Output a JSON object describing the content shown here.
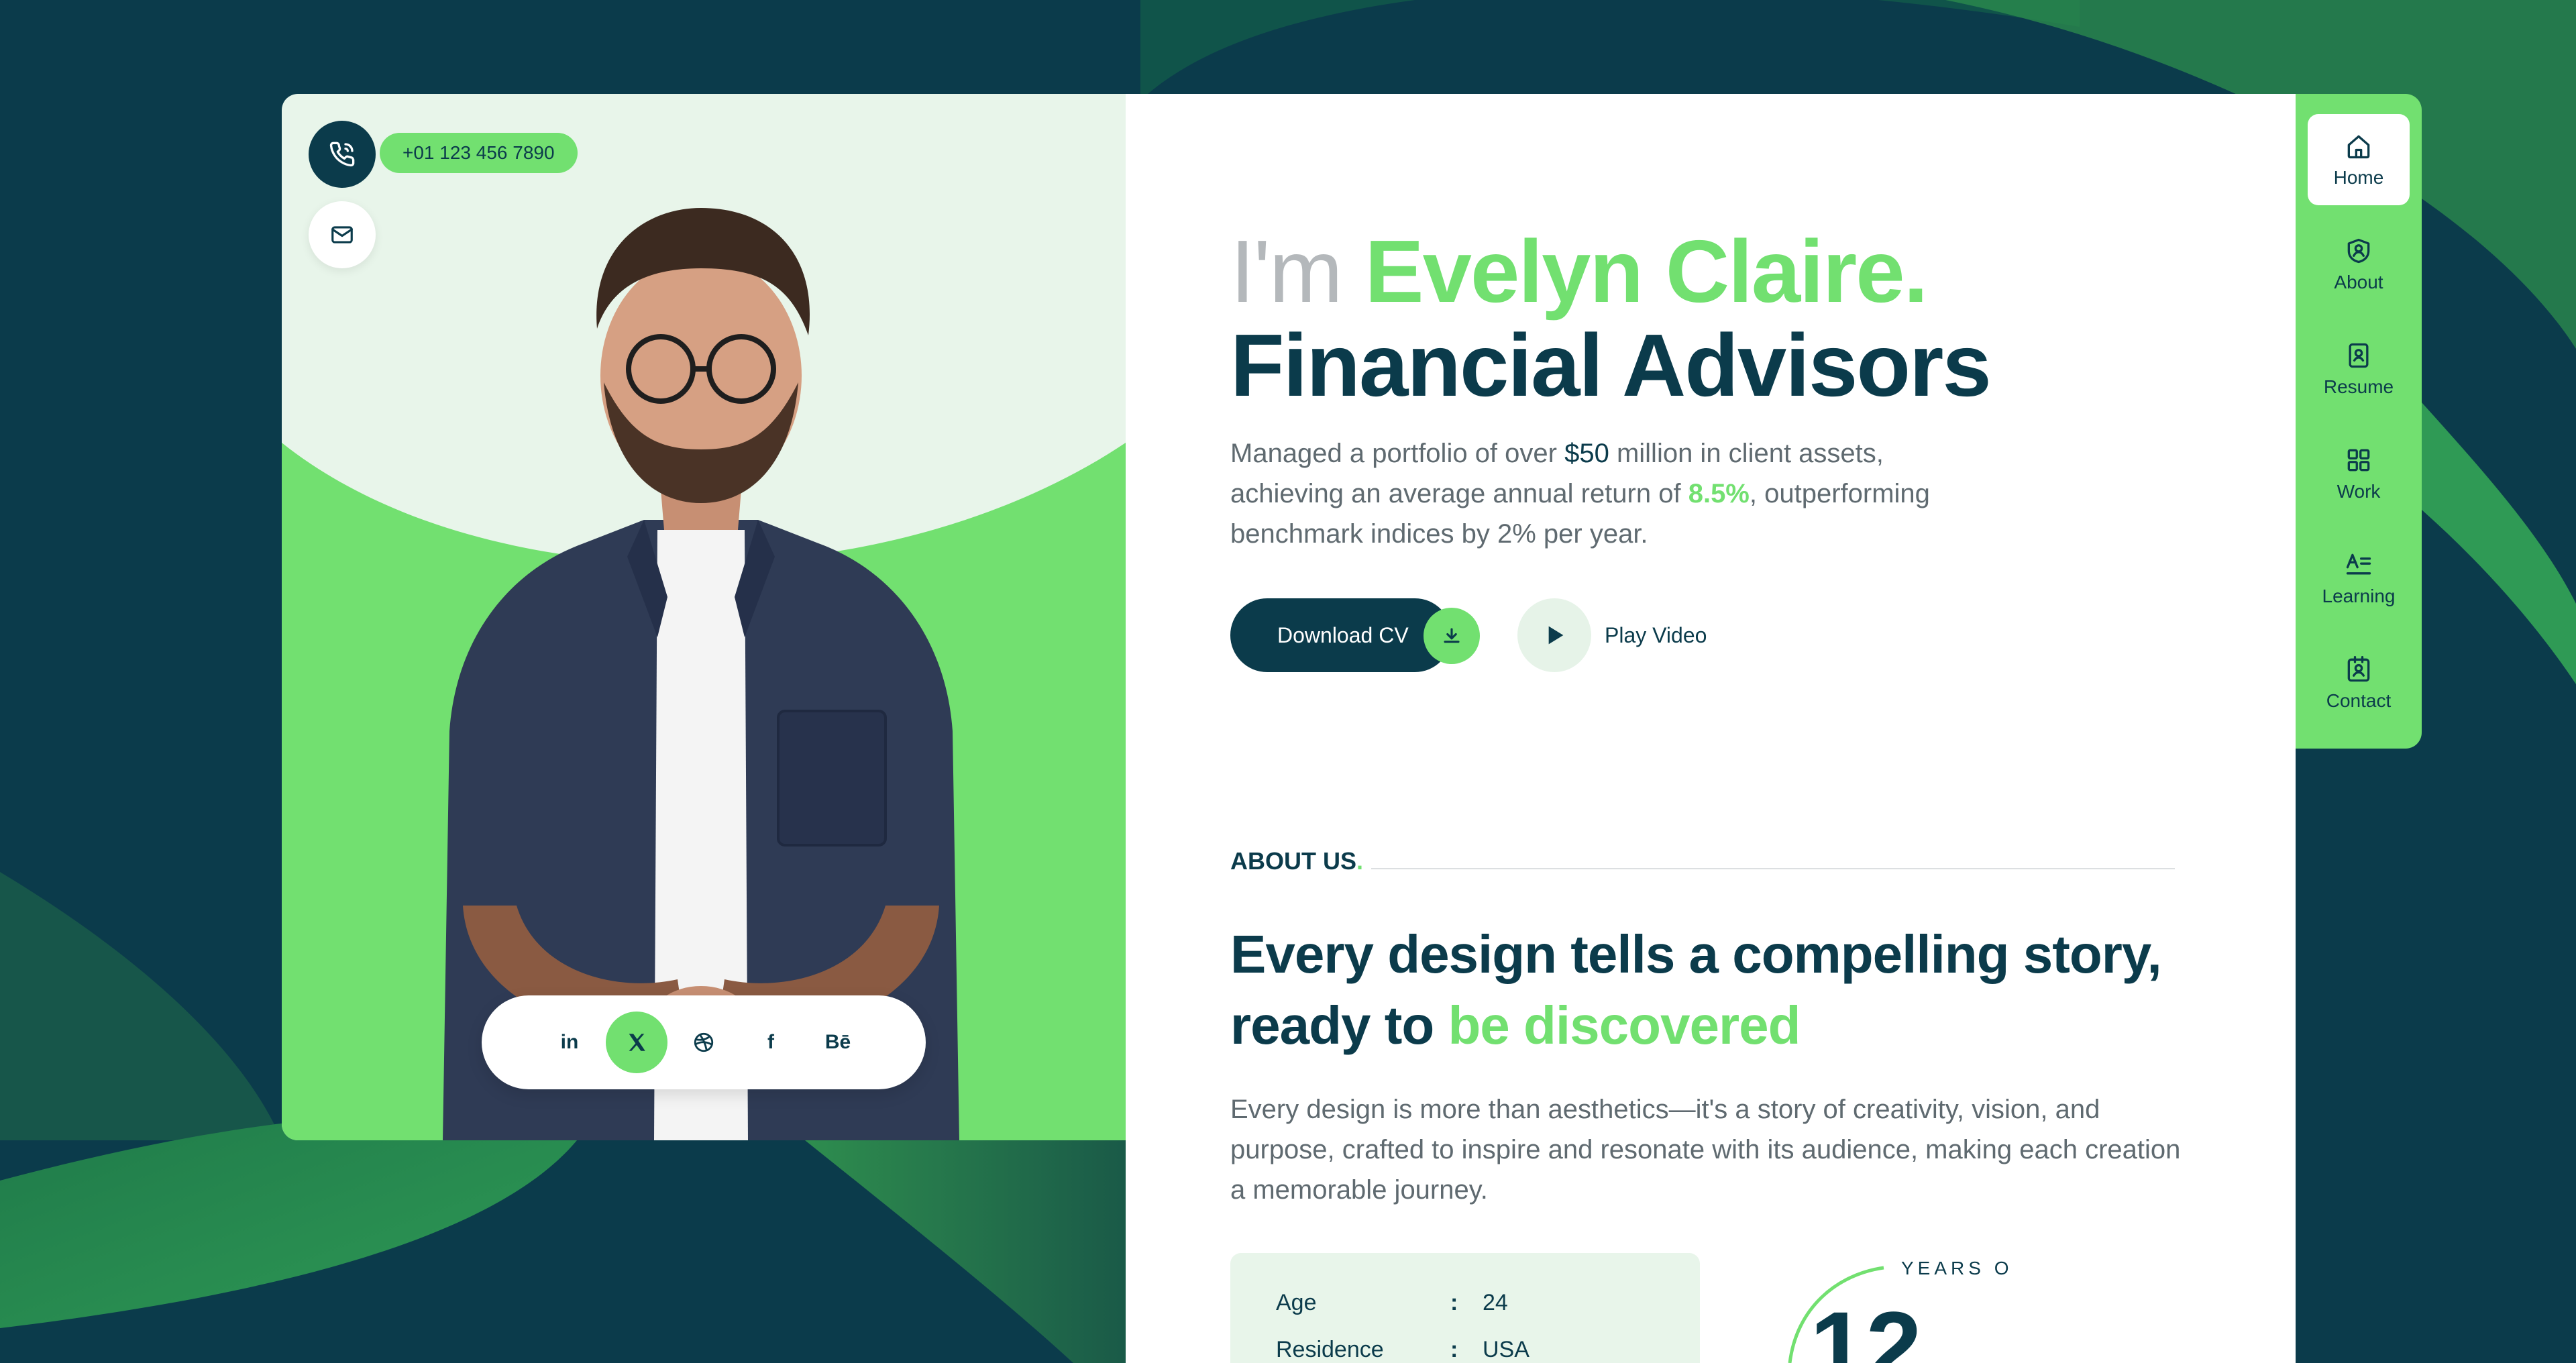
{
  "contact": {
    "phone": "+01 123 456 7890"
  },
  "social": {
    "items": [
      "in",
      "X",
      "dribbble",
      "f",
      "Bē"
    ]
  },
  "hero": {
    "greeting": "I'm ",
    "name": "Evelyn Claire.",
    "title": "Financial Advisors",
    "desc_part1": "Managed a portfolio of over ",
    "desc_amount": "$50",
    "desc_part2": " million in client assets, achieving an average annual return of ",
    "desc_rate": "8.5%",
    "desc_part3": ", outperforming benchmark indices by 2% per year.",
    "download_label": "Download CV",
    "play_label": "Play Video"
  },
  "about": {
    "label": "ABOUT US",
    "label_dot": ".",
    "heading_part1": "Every design tells a compelling story, ready to ",
    "heading_highlight": "be discovered",
    "text": "Every design is more than aesthetics—it's a story of creativity, vision, and purpose, crafted to inspire and resonate with its audience, making each creation a memorable journey.",
    "info": [
      {
        "key": "Age",
        "value": "24"
      },
      {
        "key": "Residence",
        "value": "USA"
      }
    ],
    "years_number": "12",
    "years_text": "YEARS O"
  },
  "nav": {
    "items": [
      {
        "label": "Home",
        "icon": "home-icon"
      },
      {
        "label": "About",
        "icon": "shield-user-icon"
      },
      {
        "label": "Resume",
        "icon": "resume-icon"
      },
      {
        "label": "Work",
        "icon": "grid-icon"
      },
      {
        "label": "Learning",
        "icon": "learning-icon"
      },
      {
        "label": "Contact",
        "icon": "contact-card-icon"
      }
    ]
  },
  "colors": {
    "dark": "#0b3b4b",
    "accent": "#72e070",
    "light_mint": "#e8f5ea"
  }
}
